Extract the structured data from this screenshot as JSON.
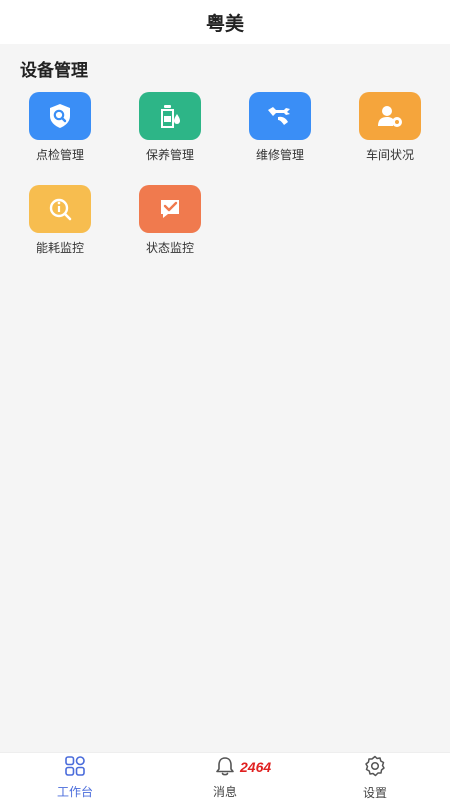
{
  "header": {
    "title": "粤美"
  },
  "section": {
    "title": "设备管理"
  },
  "tiles": [
    {
      "label": "点检管理",
      "icon": "shield-search-icon",
      "color": "#3a8ef6"
    },
    {
      "label": "保养管理",
      "icon": "oil-bottle-icon",
      "color": "#2db587"
    },
    {
      "label": "维修管理",
      "icon": "wrench-icon",
      "color": "#3a8ef6"
    },
    {
      "label": "车间状况",
      "icon": "user-gear-icon",
      "color": "#f5a53c"
    },
    {
      "label": "能耗监控",
      "icon": "magnifier-info-icon",
      "color": "#f7bd4f"
    },
    {
      "label": "状态监控",
      "icon": "flag-check-icon",
      "color": "#f07a4e"
    }
  ],
  "tabbar": {
    "items": [
      {
        "label": "工作台",
        "icon": "grid-icon"
      },
      {
        "label": "消息",
        "icon": "bell-icon"
      },
      {
        "label": "设置",
        "icon": "gear-icon"
      }
    ],
    "message_badge": "2464",
    "active_color": "#4a6cdb"
  }
}
